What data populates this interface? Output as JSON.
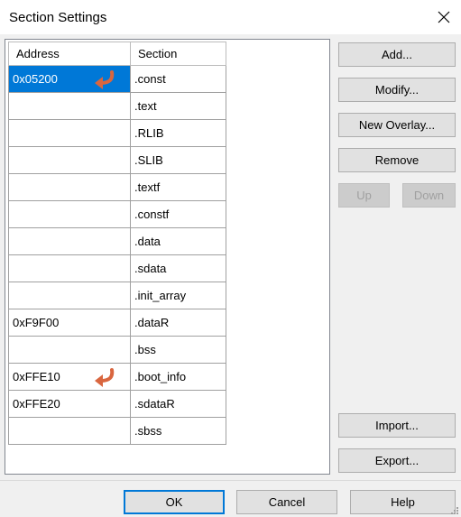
{
  "window": {
    "title": "Section Settings"
  },
  "table": {
    "headers": {
      "address": "Address",
      "section": "Section"
    },
    "rows": [
      {
        "address": "0x05200",
        "section": ".const"
      },
      {
        "address": "",
        "section": ".text"
      },
      {
        "address": "",
        "section": ".RLIB"
      },
      {
        "address": "",
        "section": ".SLIB"
      },
      {
        "address": "",
        "section": ".textf"
      },
      {
        "address": "",
        "section": ".constf"
      },
      {
        "address": "",
        "section": ".data"
      },
      {
        "address": "",
        "section": ".sdata"
      },
      {
        "address": "",
        "section": ".init_array"
      },
      {
        "address": "0xF9F00",
        "section": ".dataR"
      },
      {
        "address": "",
        "section": ".bss"
      },
      {
        "address": "0xFFE10",
        "section": ".boot_info"
      },
      {
        "address": "0xFFE20",
        "section": ".sdataR"
      },
      {
        "address": "",
        "section": ".sbss"
      }
    ],
    "selected_row": 0
  },
  "side_buttons": {
    "add": "Add...",
    "modify": "Modify...",
    "new_overlay": "New Overlay...",
    "remove": "Remove",
    "up": "Up",
    "down": "Down",
    "import": "Import...",
    "export": "Export..."
  },
  "footer_buttons": {
    "ok": "OK",
    "cancel": "Cancel",
    "help": "Help"
  },
  "colors": {
    "selection": "#0078d7",
    "annotation_arrow": "#d9663f"
  },
  "icons": {
    "close": "close-icon",
    "annotation": "curved-arrow-icon",
    "resize": "resize-grip-icon"
  }
}
